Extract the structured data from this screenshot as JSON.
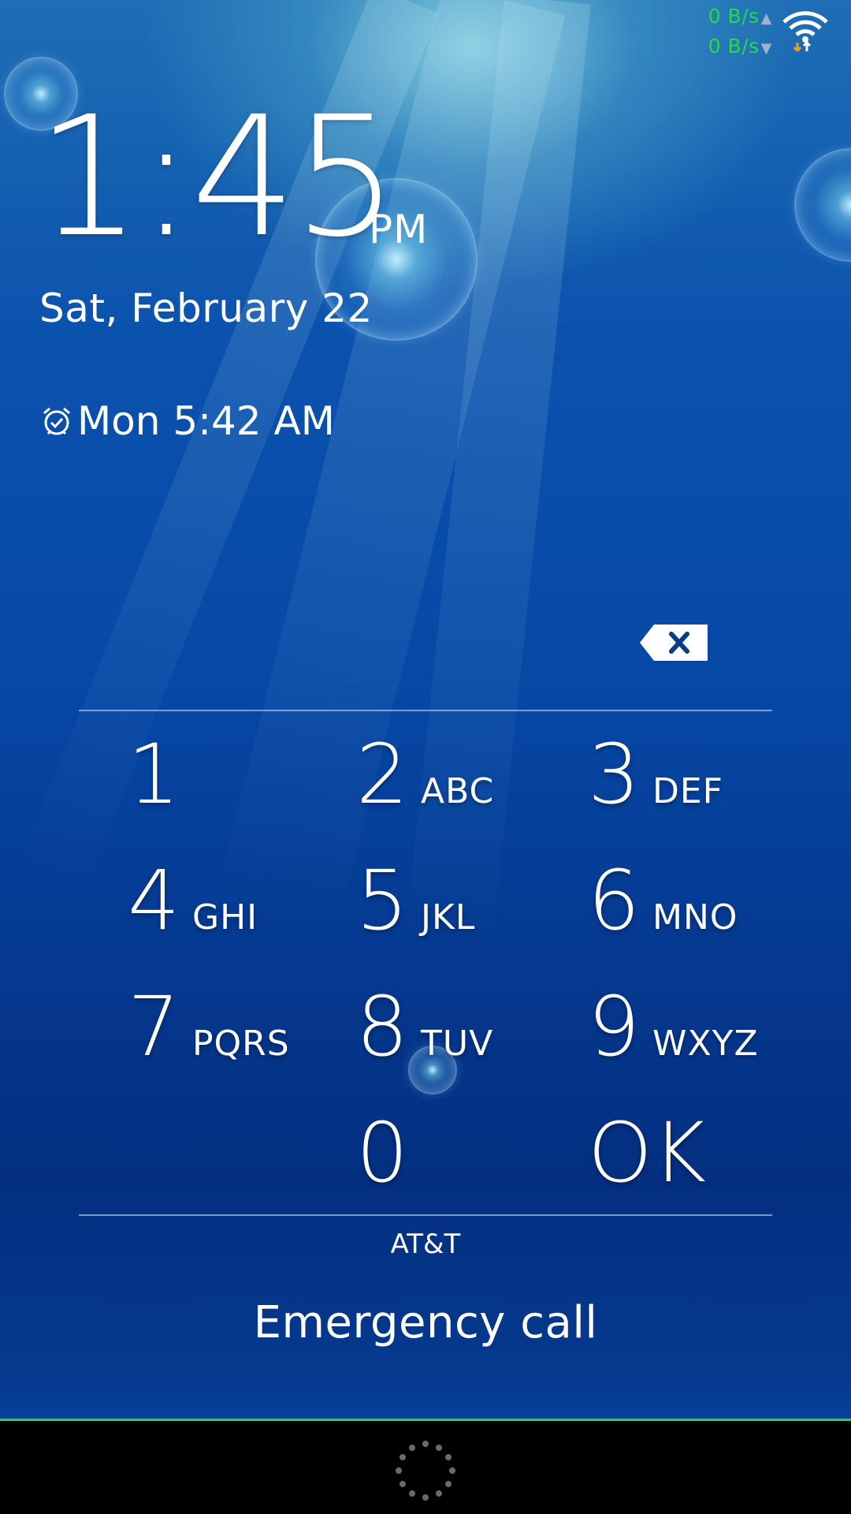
{
  "status_bar": {
    "upload_speed": "0 B/s",
    "download_speed": "0 B/s",
    "net_speed_color": "#27d84a",
    "wifi_icon": "wifi-icon"
  },
  "lockscreen": {
    "time": "1:45",
    "ampm": "PM",
    "date": "Sat, February 22",
    "alarm_icon": "alarm-clock-icon",
    "alarm": "Mon 5:42 AM"
  },
  "keypad": {
    "backspace_icon": "backspace-icon",
    "keys": [
      {
        "digit": "1",
        "letters": ""
      },
      {
        "digit": "2",
        "letters": "ABC"
      },
      {
        "digit": "3",
        "letters": "DEF"
      },
      {
        "digit": "4",
        "letters": "GHI"
      },
      {
        "digit": "5",
        "letters": "JKL"
      },
      {
        "digit": "6",
        "letters": "MNO"
      },
      {
        "digit": "7",
        "letters": "PQRS"
      },
      {
        "digit": "8",
        "letters": "TUV"
      },
      {
        "digit": "9",
        "letters": "WXYZ"
      },
      {
        "digit": "0",
        "letters": ""
      },
      {
        "digit": "OK",
        "letters": ""
      }
    ]
  },
  "footer": {
    "carrier": "AT&T",
    "emergency_call": "Emergency call"
  },
  "nav_bar": {
    "loading_icon": "loading-spinner-icon",
    "accent_line_color": "#1ed83e"
  }
}
